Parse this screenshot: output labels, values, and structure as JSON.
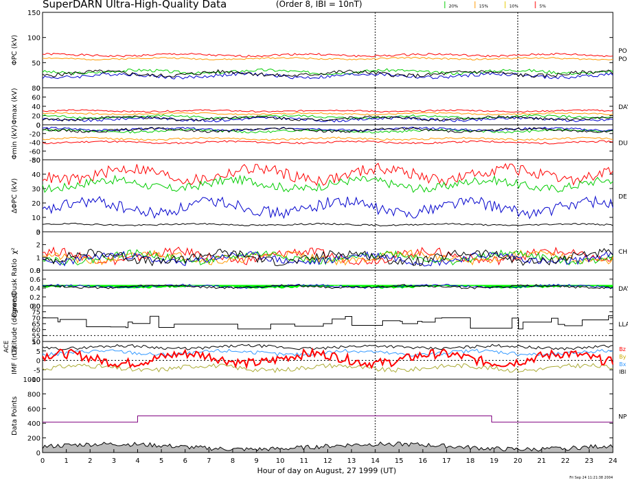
{
  "header": {
    "title": "SuperDARN Ultra-High-Quality Data",
    "subtitle": "(Order 8, IBI = 10nT)",
    "legend": [
      {
        "label": "20%",
        "color": "#00cc00"
      },
      {
        "label": "15%",
        "color": "#ff9900"
      },
      {
        "label": "10%",
        "color": "#e6c800"
      },
      {
        "label": "5%",
        "color": "#ff0000"
      }
    ]
  },
  "footer": {
    "timestamp": "Fri Sep 24 11:21:38 2004"
  },
  "chart_data": {
    "type": "line",
    "xlabel": "Hour of day on August, 27 1999 (UT)",
    "xlim": [
      0,
      24
    ],
    "x_ticks": [
      "0",
      "1",
      "2",
      "3",
      "4",
      "5",
      "6",
      "7",
      "8",
      "9",
      "10",
      "11",
      "12",
      "13",
      "14",
      "15",
      "16",
      "17",
      "18",
      "19",
      "20",
      "21",
      "22",
      "23",
      "24"
    ],
    "vertical_markers": [
      14,
      20
    ],
    "panels": [
      {
        "id": "pc",
        "ylabel": "ΦPC (kV)",
        "ylim": [
          0,
          150
        ],
        "y_ticks": [
          "0",
          "50",
          "100",
          "150"
        ],
        "right_label": "PO",
        "right_label2": "PO",
        "series": [
          {
            "color": "#ff0000",
            "base": 65,
            "amp": 4,
            "seed": 1
          },
          {
            "color": "#ff9900",
            "base": 58,
            "amp": 3,
            "seed": 2
          },
          {
            "color": "#00cc00",
            "base": 32,
            "amp": 6,
            "seed": 3
          },
          {
            "color": "#0000cc",
            "base": 24,
            "amp": 7,
            "seed": 4
          },
          {
            "color": "#000000",
            "base": 28,
            "amp": 8,
            "seed": 5
          }
        ]
      },
      {
        "id": "max",
        "ylabel": "Φmax (kV)",
        "ylim": [
          0,
          80
        ],
        "y_ticks": [
          "0",
          "20",
          "40",
          "60",
          "80"
        ],
        "right_label": "DAY",
        "series": [
          {
            "color": "#ff0000",
            "base": 30,
            "amp": 3,
            "seed": 6
          },
          {
            "color": "#ff9900",
            "base": 24,
            "amp": 3,
            "seed": 7
          },
          {
            "color": "#00cc00",
            "base": 17,
            "amp": 5,
            "seed": 8
          },
          {
            "color": "#0000cc",
            "base": 12,
            "amp": 6,
            "seed": 9
          },
          {
            "color": "#000000",
            "base": 14,
            "amp": 6,
            "seed": 10
          }
        ]
      },
      {
        "id": "min",
        "ylabel": "Φmin (kV)",
        "ylim": [
          -80,
          0
        ],
        "y_ticks": [
          "0",
          "-20",
          "-40",
          "-60",
          "-80"
        ],
        "right_label": "DU",
        "series": [
          {
            "color": "#ff0000",
            "base": -40,
            "amp": 4,
            "seed": 11
          },
          {
            "color": "#ff9900",
            "base": -32,
            "amp": 4,
            "seed": 12
          },
          {
            "color": "#00cc00",
            "base": -14,
            "amp": 5,
            "seed": 13
          },
          {
            "color": "#0000cc",
            "base": -10,
            "amp": 5,
            "seed": 14
          },
          {
            "color": "#000000",
            "base": -12,
            "amp": 6,
            "seed": 15
          }
        ]
      },
      {
        "id": "dpc",
        "ylabel": "ΔΦPC (kV)",
        "ylim": [
          0,
          50
        ],
        "y_ticks": [
          "0",
          "10",
          "20",
          "30",
          "40",
          "50"
        ],
        "right_label": "DE",
        "series": [
          {
            "color": "#ff0000",
            "base": 40,
            "amp": 8,
            "seed": 16
          },
          {
            "color": "#00cc00",
            "base": 33,
            "amp": 6,
            "seed": 17
          },
          {
            "color": "#0000cc",
            "base": 17,
            "amp": 8,
            "seed": 18
          },
          {
            "color": "#000000",
            "base": 5,
            "amp": 1,
            "seed": 19
          }
        ]
      },
      {
        "id": "chi",
        "ylabel": "χ²",
        "ylim": [
          0,
          3
        ],
        "y_ticks": [
          "0",
          "1",
          "2",
          "3"
        ],
        "right_label": "CH",
        "series": [
          {
            "color": "#ff0000",
            "base": 1.1,
            "amp": 0.7,
            "seed": 20
          },
          {
            "color": "#ff9900",
            "base": 1.0,
            "amp": 0.6,
            "seed": 21
          },
          {
            "color": "#00cc00",
            "base": 1.0,
            "amp": 0.6,
            "seed": 22
          },
          {
            "color": "#0000cc",
            "base": 0.9,
            "amp": 0.6,
            "seed": 23
          },
          {
            "color": "#000000",
            "base": 1.0,
            "amp": 0.7,
            "seed": 24
          }
        ]
      },
      {
        "id": "ratio",
        "ylabel": "Dawn/Dusk Ratio",
        "ylim": [
          0,
          0.8
        ],
        "y_ticks": [
          "0.0",
          "0.2",
          "0.4",
          "0.6",
          "0.8"
        ],
        "right_label": "DAY",
        "series": [
          {
            "color": "#00ff00",
            "base": 0.42,
            "amp": 0.04,
            "seed": 25,
            "fill": 0.47
          },
          {
            "color": "#0000cc",
            "base": 0.44,
            "amp": 0.05,
            "seed": 26
          },
          {
            "color": "#000000",
            "base": 0.43,
            "amp": 0.05,
            "seed": 27
          }
        ]
      },
      {
        "id": "lat",
        "ylabel": "Latitude (degrees)",
        "ylim": [
          50,
          80
        ],
        "y_ticks": [
          "50",
          "55",
          "60",
          "65",
          "70",
          "75",
          "80"
        ],
        "right_label": "LLA",
        "dotted": 55,
        "series": [
          {
            "color": "#000000",
            "base": 66,
            "amp": 6,
            "seed": 28,
            "step": true
          }
        ]
      },
      {
        "id": "imf",
        "ylabel": "IMF (nT)",
        "ylabel2": "ACE",
        "ylim": [
          -10,
          10
        ],
        "y_ticks": [
          "-10",
          "-5",
          "0",
          "5",
          "10"
        ],
        "right_labels": [
          {
            "text": "Bz",
            "color": "#ff0000"
          },
          {
            "text": "By",
            "color": "#ccaa00"
          },
          {
            "text": "Bx",
            "color": "#3399ff"
          },
          {
            "text": "IBI",
            "color": "#000000"
          }
        ],
        "dotted": 0,
        "series": [
          {
            "color": "#000000",
            "base": 7,
            "amp": 1.5,
            "seed": 29
          },
          {
            "color": "#3399ff",
            "base": 4,
            "amp": 2,
            "seed": 30
          },
          {
            "color": "#aaaa33",
            "base": -4,
            "amp": 2.5,
            "seed": 31
          },
          {
            "color": "#ff0000",
            "base": 1,
            "amp": 5,
            "seed": 32,
            "width": 2
          }
        ]
      },
      {
        "id": "pts",
        "ylabel": "Data Points",
        "ylim": [
          0,
          1000
        ],
        "y_ticks": [
          "0",
          "200",
          "400",
          "600",
          "800",
          "1000"
        ],
        "right_label": "NP",
        "steps": [
          [
            0,
            415
          ],
          [
            4,
            500
          ],
          [
            18.9,
            415
          ],
          [
            24,
            415
          ]
        ],
        "area_base": 80,
        "area_amp": 60
      }
    ]
  }
}
